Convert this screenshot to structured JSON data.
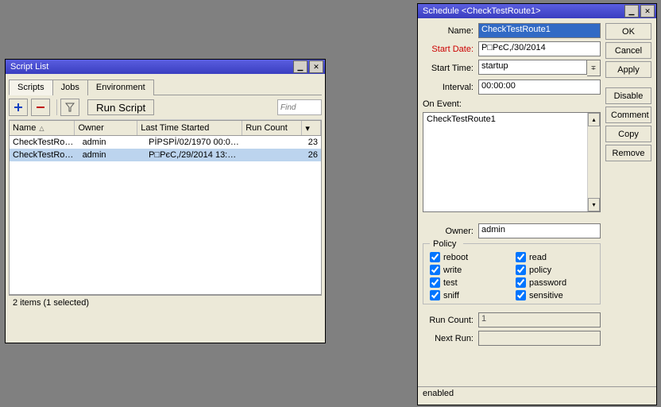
{
  "scriptList": {
    "title": "Script List",
    "tabs": [
      "Scripts",
      "Jobs",
      "Environment"
    ],
    "toolbar": {
      "run": "Run Script",
      "findPlaceholder": "Find"
    },
    "columns": {
      "name": "Name",
      "owner": "Owner",
      "lastTime": "Last Time Started",
      "runCount": "Run Count"
    },
    "rows": [
      {
        "name": "CheckTestRo…",
        "owner": "admin",
        "last": "PİPSPİ/02/1970 00:0…",
        "count": "23"
      },
      {
        "name": "CheckTestRo…",
        "owner": "admin",
        "last": "P□PєС,/29/2014 13:…",
        "count": "26"
      }
    ],
    "status": "2 items (1 selected)"
  },
  "schedule": {
    "title": "Schedule <CheckTestRoute1>",
    "labels": {
      "name": "Name:",
      "startDate": "Start Date:",
      "startTime": "Start Time:",
      "interval": "Interval:",
      "onEvent": "On Event:",
      "owner": "Owner:",
      "policy": "Policy",
      "runCount": "Run Count:",
      "nextRun": "Next Run:"
    },
    "values": {
      "name": "CheckTestRoute1",
      "startDate": "P□PєС,/30/2014",
      "startTime": "startup",
      "interval": "00:00:00",
      "onEvent": "CheckTestRoute1",
      "owner": "admin",
      "runCount": "1",
      "nextRun": ""
    },
    "policy": {
      "reboot": "reboot",
      "read": "read",
      "write": "write",
      "policyp": "policy",
      "test": "test",
      "password": "password",
      "sniff": "sniff",
      "sensitive": "sensitive"
    },
    "buttons": {
      "ok": "OK",
      "cancel": "Cancel",
      "apply": "Apply",
      "disable": "Disable",
      "comment": "Comment",
      "copy": "Copy",
      "remove": "Remove"
    },
    "status": "enabled"
  }
}
